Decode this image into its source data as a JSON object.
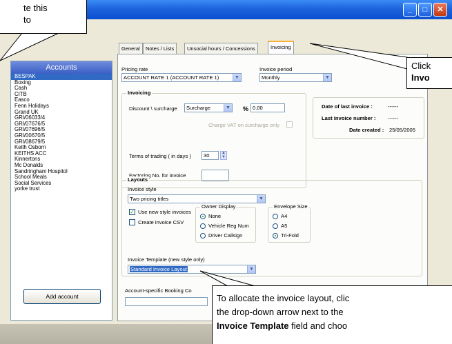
{
  "accounts": {
    "header": "Accounts",
    "items": [
      "BESPAK",
      "Boxing",
      "Cash",
      "CITB",
      "Easco",
      "Fenn Holidays",
      "Grand UK",
      "GRI/06033/4",
      "GRI/07676/5",
      "GRI/07696/5",
      "GRI/00670/5",
      "GRI/08679/5",
      "Keith Osborn",
      "KEITHS ACC",
      "Kinnertons",
      "Mc Donalds",
      "Sandringham Hospitol",
      "School Meals",
      "Social Services",
      "yorke trust"
    ],
    "selected_index": 0,
    "add_button": "Add account"
  },
  "tabs": [
    "General",
    "Notes / Lists",
    "Unsocial hours / Concessions",
    "Invoicing"
  ],
  "active_tab": 3,
  "pricing": {
    "label": "Pricing rate",
    "value": "ACCOUNT RATE 1 (ACCOUNT RATE 1)"
  },
  "period": {
    "label": "Invoice period",
    "value": "Monthly"
  },
  "invoicing": {
    "title": "Invoicing",
    "discount_label": "Discount \\ surcharge",
    "discount_value": "Surcharge",
    "percent_symbol": "%",
    "percent_value": "0.00",
    "vat_label": "Charge VAT on surcharge only",
    "terms_label": "Terms of trading ( in days )",
    "terms_value": "30",
    "factoring_label": "Factoring No. for invoice",
    "factoring_value": ""
  },
  "info": {
    "last_invoice_label": "Date of last invoice :",
    "last_invoice_value": "------",
    "last_number_label": "Last invoice number :",
    "last_number_value": "------",
    "created_label": "Date created :",
    "created_value": "25/05/2005"
  },
  "layouts": {
    "title": "Layouts",
    "style_label": "Invoice style",
    "style_value": "Two pricing titles",
    "new_style_label": "Use new style invoices",
    "new_style_checked": true,
    "csv_label": "Create invoice CSV",
    "csv_checked": false,
    "owner": {
      "title": "Owner Display",
      "options": [
        "None",
        "Vehicle Reg Num",
        "Driver Callsign"
      ],
      "selected": 0
    },
    "envelope": {
      "title": "Envelope Size",
      "options": [
        "A4",
        "A5",
        "Tri-Fold"
      ],
      "selected": 2
    },
    "template_label": "Invoice Template (new style only)",
    "template_value": "Standard Invoice Layout"
  },
  "booking": {
    "label": "Account-specific Booking Co"
  },
  "callouts": {
    "top_left": [
      "te this",
      "to"
    ],
    "right": [
      "Click",
      "Invo"
    ],
    "bottom": [
      "To allocate the invoice layout, clic",
      "the drop-down arrow next to the",
      "Invoice Template field and choo"
    ],
    "bottom_bold_part": "Invoice Template",
    "bottom_rest": " field and choo"
  },
  "colors": {
    "title_blue": "#0a4fd0",
    "selection": "#316ac5",
    "tab_highlight": "#f8b230",
    "check_green": "#21a121"
  }
}
